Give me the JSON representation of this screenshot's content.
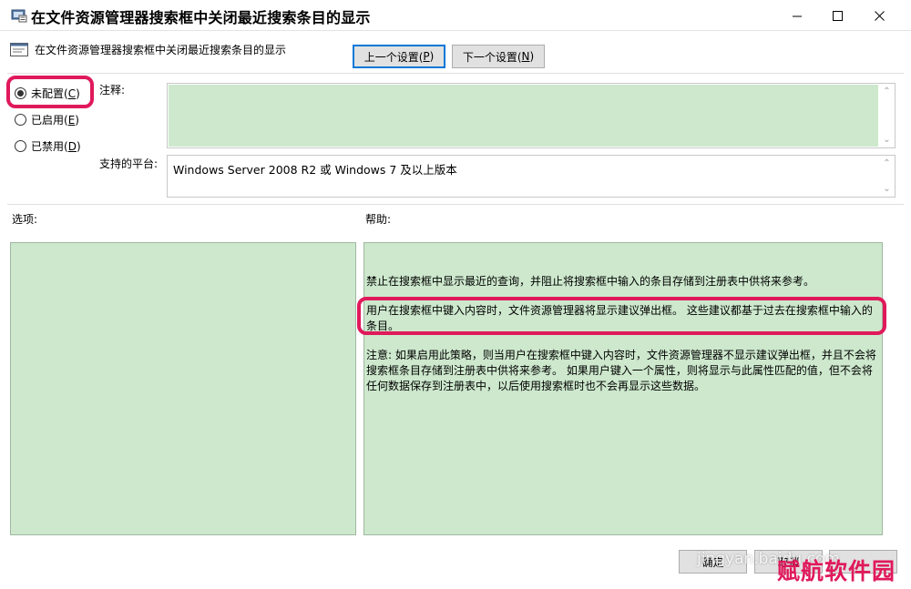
{
  "window": {
    "title": "在文件资源管理器搜索框中关闭最近搜索条目的显示",
    "icon": "policy-settings-icon"
  },
  "header": {
    "policy_name": "在文件资源管理器搜索框中关闭最近搜索条目的显示",
    "prev_button": {
      "text": "上一个设置(",
      "key": "P",
      "close": ")"
    },
    "next_button": {
      "text": "下一个设置(",
      "key": "N",
      "close": ")"
    }
  },
  "options": [
    {
      "text": "未配置(",
      "key": "C",
      "close": ")",
      "selected": true
    },
    {
      "text": "已启用(",
      "key": "E",
      "close": ")",
      "selected": false
    },
    {
      "text": "已禁用(",
      "key": "D",
      "close": ")",
      "selected": false
    }
  ],
  "comment_label": "注释:",
  "comment_value": "",
  "platform_label": "支持的平台:",
  "platform_value": "Windows Server 2008 R2 或 Windows 7 及以上版本",
  "options_label": "选项:",
  "help_label": "帮助:",
  "help_paragraphs": [
    "禁止在搜索框中显示最近的查询，并阻止将搜索框中输入的条目存储到注册表中供将来参考。",
    "用户在搜索框中键入内容时，文件资源管理器将显示建议弹出框。 这些建议都基于过去在搜索框中输入的条目。",
    "注意: 如果启用此策略，则当用户在搜索框中键入内容时，文件资源管理器不显示建议弹出框，并且不会将搜索框条目存储到注册表中供将来参考。 如果用户键入一个属性，则将显示与此属性匹配的值，但不会将任何数据保存到注册表中，以后使用搜索框时也不会再显示这些数据。"
  ],
  "footer": {
    "ok_button": "确定",
    "cancel_button": "取消"
  },
  "watermark": {
    "text": "jingyan.baidu.com",
    "brand": "赋航软件园"
  },
  "colors": {
    "field_green": "#cde8cd",
    "highlight": "#e0195b",
    "button_face": "#e1e1e1",
    "accent_border": "#0078d7"
  }
}
